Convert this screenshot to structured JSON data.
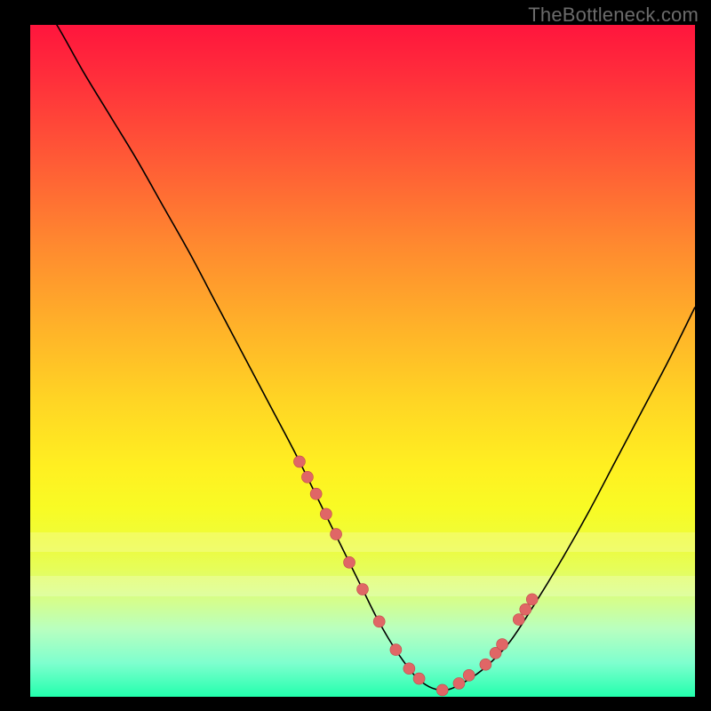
{
  "watermark": "TheBottleneck.com",
  "colors": {
    "page_bg": "#000000",
    "watermark_text": "#6b6b6b",
    "curve_stroke": "#000000",
    "dot_fill": "#e06666",
    "dot_stroke": "#c24a4a"
  },
  "chart_data": {
    "type": "line",
    "title": "",
    "xlabel": "",
    "ylabel": "",
    "xlim": [
      0,
      100
    ],
    "ylim": [
      0,
      100
    ],
    "legend": false,
    "grid": false,
    "annotations": [],
    "series": [
      {
        "name": "bottleneck-curve",
        "x": [
          0,
          4,
          8,
          12,
          16,
          20,
          24,
          28,
          32,
          36,
          40,
          44,
          48,
          50,
          52,
          54,
          56,
          58,
          60,
          62,
          64,
          68,
          72,
          76,
          80,
          84,
          88,
          92,
          96,
          100
        ],
        "y": [
          106,
          100,
          93,
          86.5,
          80,
          73,
          66,
          58.5,
          51,
          43.5,
          36,
          28,
          20,
          16,
          12,
          8.5,
          5.5,
          3,
          1.5,
          1,
          1.5,
          4,
          8,
          14,
          20.5,
          27.5,
          35,
          42.5,
          50,
          58
        ]
      }
    ],
    "highlight_dots": {
      "name": "threshold-markers",
      "x": [
        40.5,
        41.7,
        43.0,
        44.5,
        46.0,
        48.0,
        50.0,
        52.5,
        55.0,
        57.0,
        58.5,
        62.0,
        64.5,
        66.0,
        68.5,
        70.0,
        71.0,
        73.5,
        74.5,
        75.5
      ],
      "y": [
        35.0,
        32.7,
        30.2,
        27.2,
        24.2,
        20.0,
        16.0,
        11.2,
        7.0,
        4.2,
        2.7,
        1.0,
        2.0,
        3.2,
        4.8,
        6.5,
        7.8,
        11.5,
        13.0,
        14.5
      ]
    },
    "pale_bands_y": [
      [
        21.5,
        24.5
      ],
      [
        15.0,
        18.0
      ]
    ]
  }
}
